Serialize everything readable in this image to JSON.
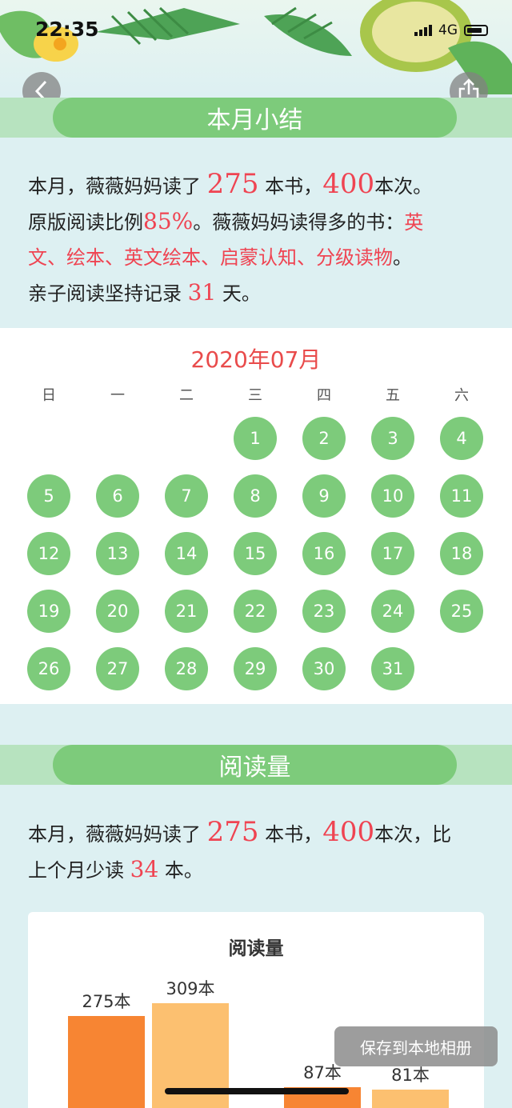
{
  "status": {
    "time": "22:35",
    "network": "4G"
  },
  "summary": {
    "title": "本月小结",
    "l1_a": "本月，薇薇妈妈读了 ",
    "books": "275",
    "l1_b": " 本书，",
    "times": "400",
    "l1_c": "本次。",
    "l2_a": "原版阅读比例",
    "ratio": "85%",
    "l2_b": "。薇薇妈妈读得多的书：",
    "t1": "英",
    "l3_topics": "文、绘本、英文绘本、启蒙认知、分级读物",
    "l3_end": "。",
    "l4_a": "亲子阅读坚持记录 ",
    "days": "31",
    "l4_b": " 天。"
  },
  "calendar": {
    "title": "2020年07月",
    "weekdays": [
      "日",
      "一",
      "二",
      "三",
      "四",
      "五",
      "六"
    ],
    "days": [
      "1",
      "2",
      "3",
      "4",
      "5",
      "6",
      "7",
      "8",
      "9",
      "10",
      "11",
      "12",
      "13",
      "14",
      "15",
      "16",
      "17",
      "18",
      "19",
      "20",
      "21",
      "22",
      "23",
      "24",
      "25",
      "26",
      "27",
      "28",
      "29",
      "30",
      "31"
    ]
  },
  "reading": {
    "title": "阅读量",
    "l1_a": "本月，薇薇妈妈读了 ",
    "books": "275",
    "l1_b": " 本书，",
    "times": "400",
    "l1_c": "本次，比",
    "l2_a": "上个月少读 ",
    "diff": "34",
    "l2_b": " 本。"
  },
  "chart_data": {
    "type": "bar",
    "title": "阅读量",
    "categories": [
      "",
      "",
      "",
      ""
    ],
    "values": [
      275,
      309,
      87,
      81
    ],
    "labels": [
      "275本",
      "309本",
      "87本",
      "81本"
    ],
    "colors": [
      "#f78533",
      "#fcc070",
      "#f78533",
      "#fcc070"
    ]
  },
  "buttons": {
    "save": "保存到本地相册"
  }
}
